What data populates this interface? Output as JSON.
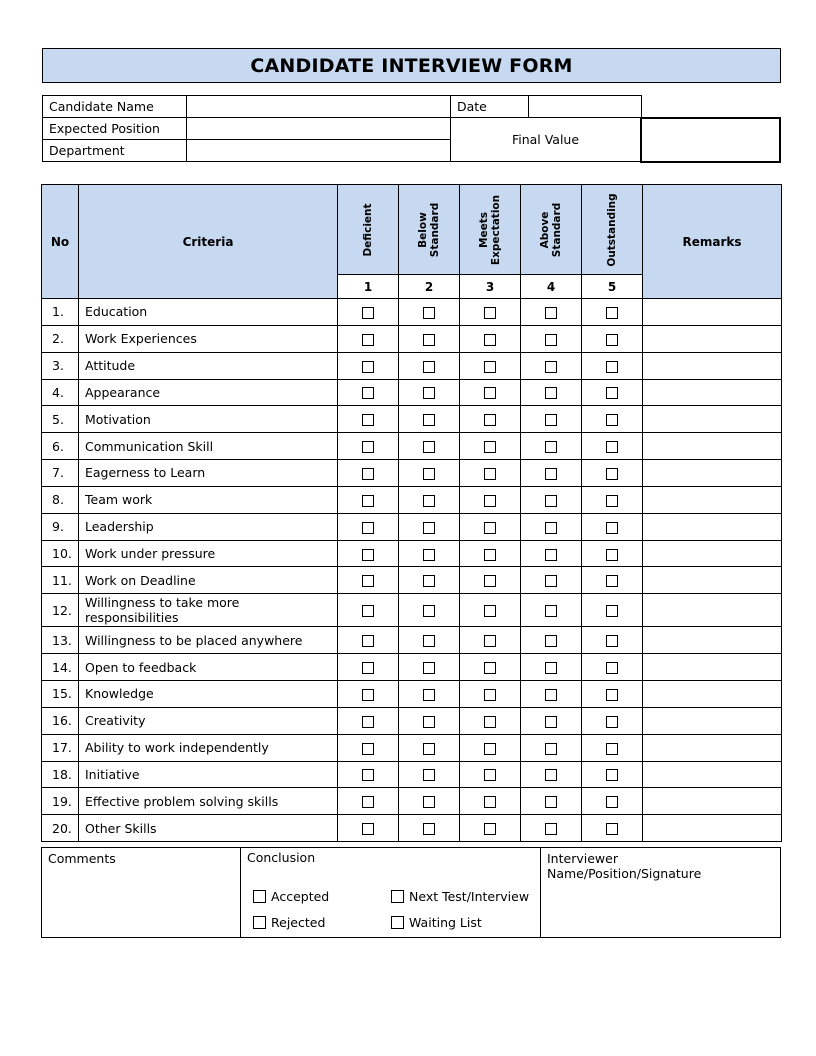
{
  "title": "CANDIDATE INTERVIEW FORM",
  "info": {
    "candidate_name_label": "Candidate Name",
    "candidate_name_value": "",
    "expected_position_label": "Expected Position",
    "expected_position_value": "",
    "department_label": "Department",
    "department_value": "",
    "date_label": "Date",
    "date_value": "",
    "final_value_label": "Final Value",
    "final_value": ""
  },
  "table": {
    "headers": {
      "no": "No",
      "criteria": "Criteria",
      "remarks": "Remarks"
    },
    "ratings": [
      {
        "label_line1": "Deficient",
        "label_line2": "",
        "score": "1"
      },
      {
        "label_line1": "Below",
        "label_line2": "Standard",
        "score": "2"
      },
      {
        "label_line1": "Meets",
        "label_line2": "Expectation",
        "score": "3"
      },
      {
        "label_line1": "Above",
        "label_line2": "Standard",
        "score": "4"
      },
      {
        "label_line1": "Outstanding",
        "label_line2": "",
        "score": "5"
      }
    ],
    "rows": [
      {
        "no": "1.",
        "criteria": "Education"
      },
      {
        "no": "2.",
        "criteria": "Work Experiences"
      },
      {
        "no": "3.",
        "criteria": "Attitude"
      },
      {
        "no": "4.",
        "criteria": "Appearance"
      },
      {
        "no": "5.",
        "criteria": "Motivation"
      },
      {
        "no": "6.",
        "criteria": "Communication Skill"
      },
      {
        "no": "7.",
        "criteria": "Eagerness to Learn"
      },
      {
        "no": "8.",
        "criteria": "Team work"
      },
      {
        "no": "9.",
        "criteria": "Leadership"
      },
      {
        "no": "10.",
        "criteria": "Work under pressure"
      },
      {
        "no": "11.",
        "criteria": "Work on Deadline"
      },
      {
        "no": "12.",
        "criteria": "Willingness to take more responsibilities"
      },
      {
        "no": "13.",
        "criteria": "Willingness to be placed anywhere"
      },
      {
        "no": "14.",
        "criteria": "Open to feedback"
      },
      {
        "no": "15.",
        "criteria": "Knowledge"
      },
      {
        "no": "16.",
        "criteria": "Creativity"
      },
      {
        "no": "17.",
        "criteria": "Ability to work independently"
      },
      {
        "no": "18.",
        "criteria": "Initiative"
      },
      {
        "no": "19.",
        "criteria": "Effective problem solving skills"
      },
      {
        "no": "20.",
        "criteria": "Other Skills"
      }
    ]
  },
  "bottom": {
    "comments_label": "Comments",
    "conclusion_label": "Conclusion",
    "interviewer_label": "Interviewer Name/Position/Signature",
    "options": {
      "accepted": "Accepted",
      "rejected": "Rejected",
      "next_test": "Next Test/Interview",
      "waiting_list": "Waiting List"
    }
  }
}
